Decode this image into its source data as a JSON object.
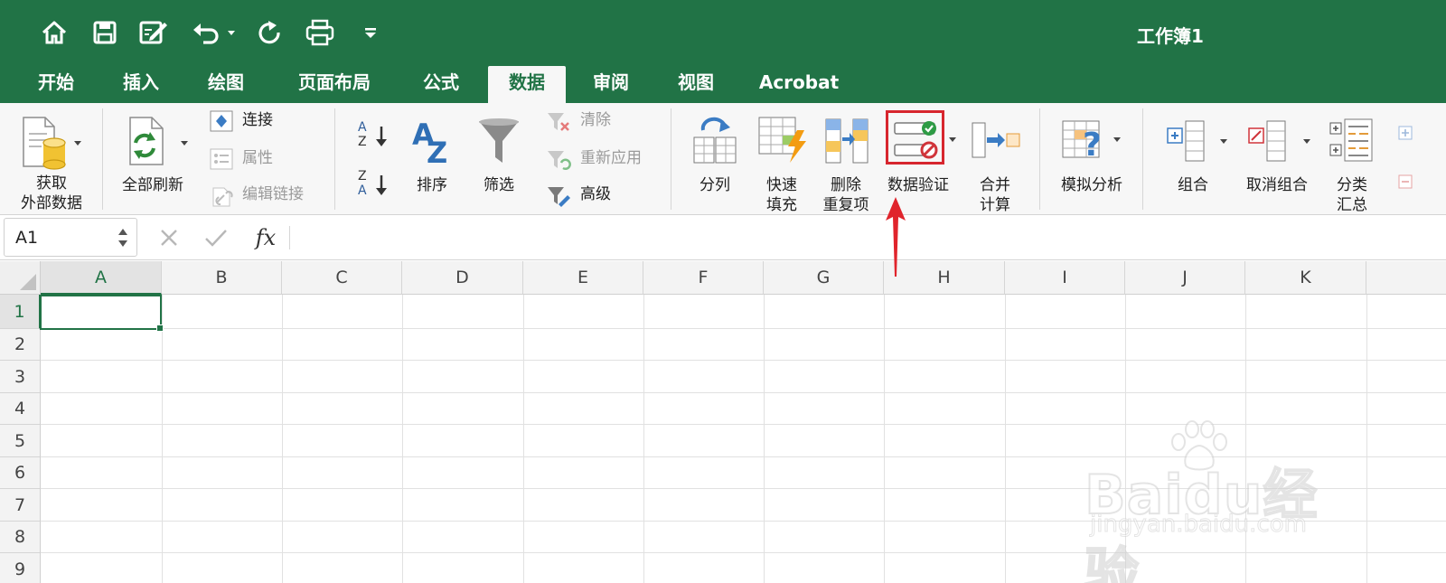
{
  "app": {
    "doc_title": "工作簿1"
  },
  "quick_access": [
    "home-icon",
    "save-icon",
    "edit-icon",
    "undo-icon",
    "redo-icon",
    "print-icon",
    "customize-icon"
  ],
  "tabs": [
    {
      "label": "开始",
      "active": false
    },
    {
      "label": "插入",
      "active": false
    },
    {
      "label": "绘图",
      "active": false
    },
    {
      "label": "页面布局",
      "active": false
    },
    {
      "label": "公式",
      "active": false
    },
    {
      "label": "数据",
      "active": true
    },
    {
      "label": "审阅",
      "active": false
    },
    {
      "label": "视图",
      "active": false
    },
    {
      "label": "Acrobat",
      "active": false
    }
  ],
  "ribbon": {
    "get_data": {
      "line1": "获取",
      "line2": "外部数据"
    },
    "refresh_all": "全部刷新",
    "connections": "连接",
    "properties": "属性",
    "edit_links": "编辑链接",
    "sort": "排序",
    "filter": "筛选",
    "clear": "清除",
    "reapply": "重新应用",
    "advanced": "高级",
    "text_to_columns": "分列",
    "flash_fill": {
      "line1": "快速",
      "line2": "填充"
    },
    "remove_duplicates": {
      "line1": "删除",
      "line2": "重复项"
    },
    "data_validation": "数据验证",
    "consolidate": {
      "line1": "合并",
      "line2": "计算"
    },
    "what_if": "模拟分析",
    "group": "组合",
    "ungroup": "取消组合",
    "subtotal": {
      "line1": "分类",
      "line2": "汇总"
    }
  },
  "formula_bar": {
    "name_box": "A1",
    "fx": "fx",
    "value": ""
  },
  "sheet": {
    "columns": [
      "A",
      "B",
      "C",
      "D",
      "E",
      "F",
      "G",
      "H",
      "I",
      "J",
      "K"
    ],
    "rows": [
      "1",
      "2",
      "3",
      "4",
      "5",
      "6",
      "7",
      "8",
      "9"
    ],
    "active_cell": "A1"
  },
  "colors": {
    "brand": "#217346",
    "highlight": "#d7262e"
  },
  "watermark": {
    "text": "Baidu经验",
    "url": "jingyan.baidu.com"
  }
}
